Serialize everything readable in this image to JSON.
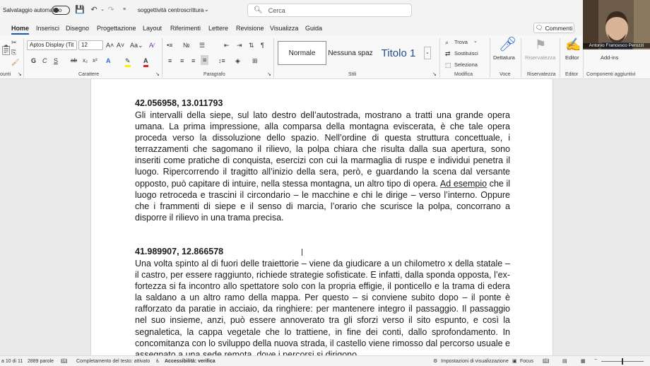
{
  "titlebar": {
    "autosave_label": "Salvataggio automatico",
    "document_name": "soggettività centroscrittura",
    "search_placeholder": "Cerca"
  },
  "menu": {
    "tabs": [
      "Home",
      "Inserisci",
      "Disegno",
      "Progettazione",
      "Layout",
      "Riferimenti",
      "Lettere",
      "Revisione",
      "Visualizza",
      "Guida"
    ],
    "active_tab": "Home",
    "comments_label": "Commenti"
  },
  "ribbon": {
    "font_name": "Aptos Display (Tit",
    "font_size": "12",
    "groups": {
      "clipboard": "ounti",
      "font": "Carattere",
      "paragraph": "Paragrafo",
      "styles": "Stili",
      "editing": "Modifica",
      "voice": "Voce",
      "sensitivity": "Riservatezza",
      "editor": "Editor",
      "addins": "Componenti aggiuntivi"
    },
    "styles": [
      "Normale",
      "Nessuna spaz",
      "Titolo 1"
    ],
    "editing_items": [
      "Trova",
      "Sostituisci",
      "Seleziona"
    ],
    "dictate": "Dettatura",
    "sensitivity_btn": "Riservatezza",
    "editor_btn": "Editor",
    "addins_btn": "Add-ins"
  },
  "webcam": {
    "participant_name": "Antonio Francesco Perozzi"
  },
  "document": {
    "sections": [
      {
        "coordinates": "42.056958, 13.011793",
        "text_before": "Gli intervalli della siepe, sul lato destro dell’autostrada, mostrano a tratti una grande opera umana. La prima impressione, alla comparsa della montagna eviscerata, è che tale opera proceda verso la dissoluzione dello spazio. Nell’ordine di questa struttura concettuale, i terrazzamenti che sagomano il rilievo, la polpa chiara che risulta dalla sua apertura, sono inseriti come pratiche di conquista, esercizi con cui la marmaglia di ruspe e individui penetra il luogo. Ripercorrendo il tragitto all’inizio della sera, però, e guardando la scena dal versante opposto, può capitare di intuire, nella stessa montagna, un altro tipo di opera. ",
        "underlined": "Ad esempio",
        "text_after": " che il luogo retroceda e trascini il circondario – le macchine e chi le dirige – verso l’interno. Oppure che i frammenti di siepe e il senso di marcia, l’orario che scurisce la polpa, concorrano a disporre il rilievo in una trama precisa."
      },
      {
        "coordinates": "41.989907, 12.866578",
        "text_before": "Una volta spinto al di fuori delle traiettorie – viene da giudicare a un chilometro x della statale – il castro, per essere raggiunto, richiede strategie sofisticate. E infatti, dalla sponda opposta, l’ex-fortezza si fa incontro allo spettatore solo con la propria effigie, il ponticello e la trama di edera la saldano a un altro ramo della mappa. Per questo – si conviene subito dopo – il ponte è rafforzato da paratie in acciaio, da ringhiere: per mantenere integro il passaggio. Il passaggio nel suo insieme, anzi, può essere annoverato tra gli sforzi verso il sito espunto, e così la segnaletica, la cappa vegetale che lo trattiene, in fine dei conti, dallo sprofondamento. In concomitanza con lo sviluppo della nuova strada, il castello viene rimosso dal percorso usuale e assegnato a una sede remota, dove i percorsi si dirigono.",
        "underlined": "",
        "text_after": ""
      }
    ]
  },
  "status": {
    "page": "a 10 di 11",
    "words": "2889 parole",
    "text_predictions": "Completamento del testo: attivato",
    "accessibility": "Accessibilità: verifica",
    "display_settings": "Impostazioni di visualizzazione",
    "focus": "Focus"
  }
}
